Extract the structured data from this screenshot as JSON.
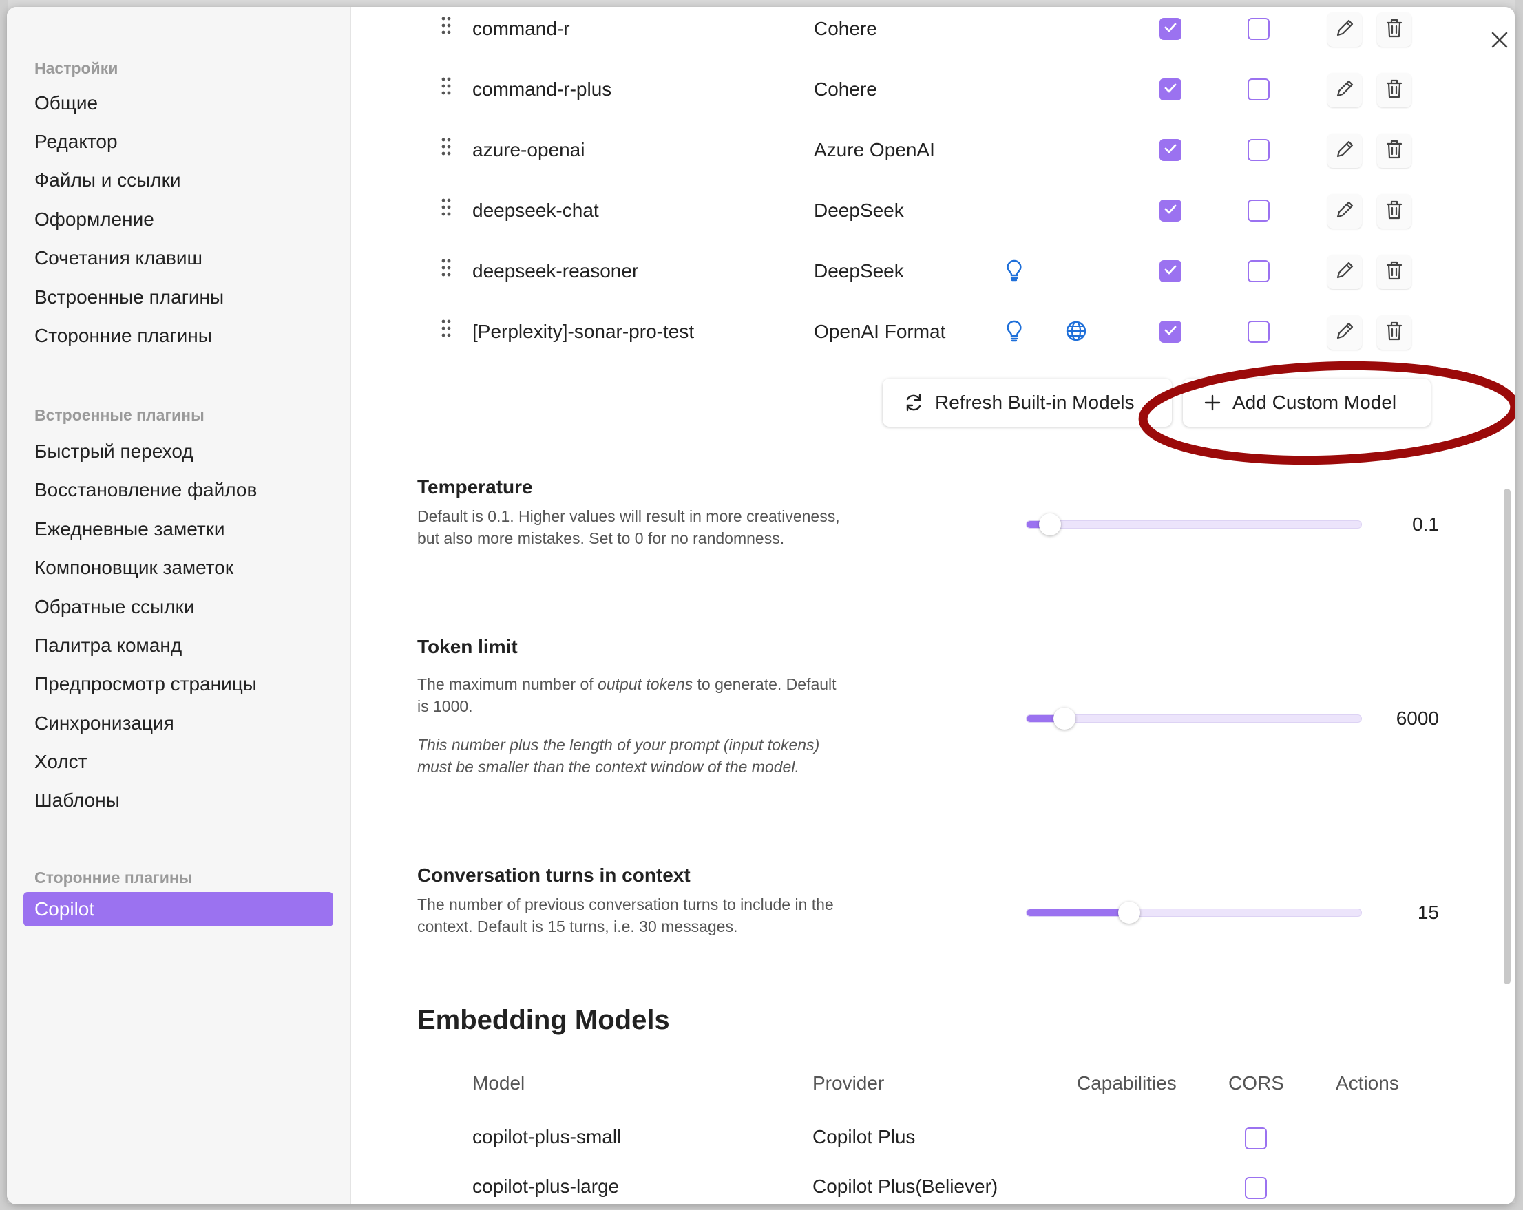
{
  "sidebar": {
    "groups": [
      {
        "title": "Настройки",
        "items": [
          "Общие",
          "Редактор",
          "Файлы и ссылки",
          "Оформление",
          "Сочетания клавиш",
          "Встроенные плагины",
          "Сторонние плагины"
        ]
      },
      {
        "title": "Встроенные плагины",
        "items": [
          "Быстрый переход",
          "Восстановление файлов",
          "Ежедневные заметки",
          "Компоновщик заметок",
          "Обратные ссылки",
          "Палитра команд",
          "Предпросмотр страницы",
          "Синхронизация",
          "Холст",
          "Шаблоны"
        ]
      },
      {
        "title": "Сторонние плагины",
        "items": [
          "Copilot"
        ]
      }
    ],
    "active_item": "Copilot"
  },
  "chat_models": [
    {
      "name": "command-r",
      "provider": "Cohere",
      "reasoning": false,
      "websearch": false,
      "enabled": true,
      "cors": false
    },
    {
      "name": "command-r-plus",
      "provider": "Cohere",
      "reasoning": false,
      "websearch": false,
      "enabled": true,
      "cors": false
    },
    {
      "name": "azure-openai",
      "provider": "Azure OpenAI",
      "reasoning": false,
      "websearch": false,
      "enabled": true,
      "cors": false
    },
    {
      "name": "deepseek-chat",
      "provider": "DeepSeek",
      "reasoning": false,
      "websearch": false,
      "enabled": true,
      "cors": false
    },
    {
      "name": "deepseek-reasoner",
      "provider": "DeepSeek",
      "reasoning": true,
      "websearch": false,
      "enabled": true,
      "cors": false
    },
    {
      "name": "[Perplexity]-sonar-pro-test",
      "provider": "OpenAI Format",
      "reasoning": true,
      "websearch": true,
      "enabled": true,
      "cors": false
    }
  ],
  "buttons": {
    "refresh_label": "Refresh Built-in Models",
    "add_label": "Add Custom Model"
  },
  "settings": {
    "temperature": {
      "title": "Temperature",
      "desc": "Default is 0.1. Higher values will result in more creativeness, but also more mistakes. Set to 0 for no randomness.",
      "value": "0.1",
      "min": 0,
      "max": 2,
      "current": 0.1
    },
    "token_limit": {
      "title": "Token limit",
      "desc_pre": "The maximum number of ",
      "desc_em": "output tokens",
      "desc_post": " to generate. Default is 1000.",
      "note": "This number plus the length of your prompt (input tokens) must be smaller than the context window of the model.",
      "value": "6000",
      "min": 0,
      "max": 65000,
      "current": 6000
    },
    "conversation_turns": {
      "title": "Conversation turns in context",
      "desc": "The number of previous conversation turns to include in the context. Default is 15 turns, i.e. 30 messages.",
      "value": "15",
      "min": 1,
      "max": 50,
      "current": 15
    }
  },
  "embedding": {
    "title": "Embedding Models",
    "headers": {
      "model": "Model",
      "provider": "Provider",
      "capabilities": "Capabilities",
      "cors": "CORS",
      "actions": "Actions"
    },
    "rows": [
      {
        "name": "copilot-plus-small",
        "provider": "Copilot Plus",
        "cors": false
      },
      {
        "name": "copilot-plus-large",
        "provider": "Copilot Plus(Believer)",
        "cors": false
      }
    ]
  },
  "colors": {
    "accent": "#9b72f0",
    "annotation": "#9b0a0a",
    "icon_blue": "#1e6fd9"
  },
  "icons": {
    "drag": "drag-handle-icon",
    "bulb": "lightbulb-icon",
    "globe": "globe-icon",
    "check": "check-icon",
    "edit": "pencil-icon",
    "delete": "trash-icon",
    "refresh": "refresh-icon",
    "plus": "plus-icon",
    "close": "close-icon"
  }
}
